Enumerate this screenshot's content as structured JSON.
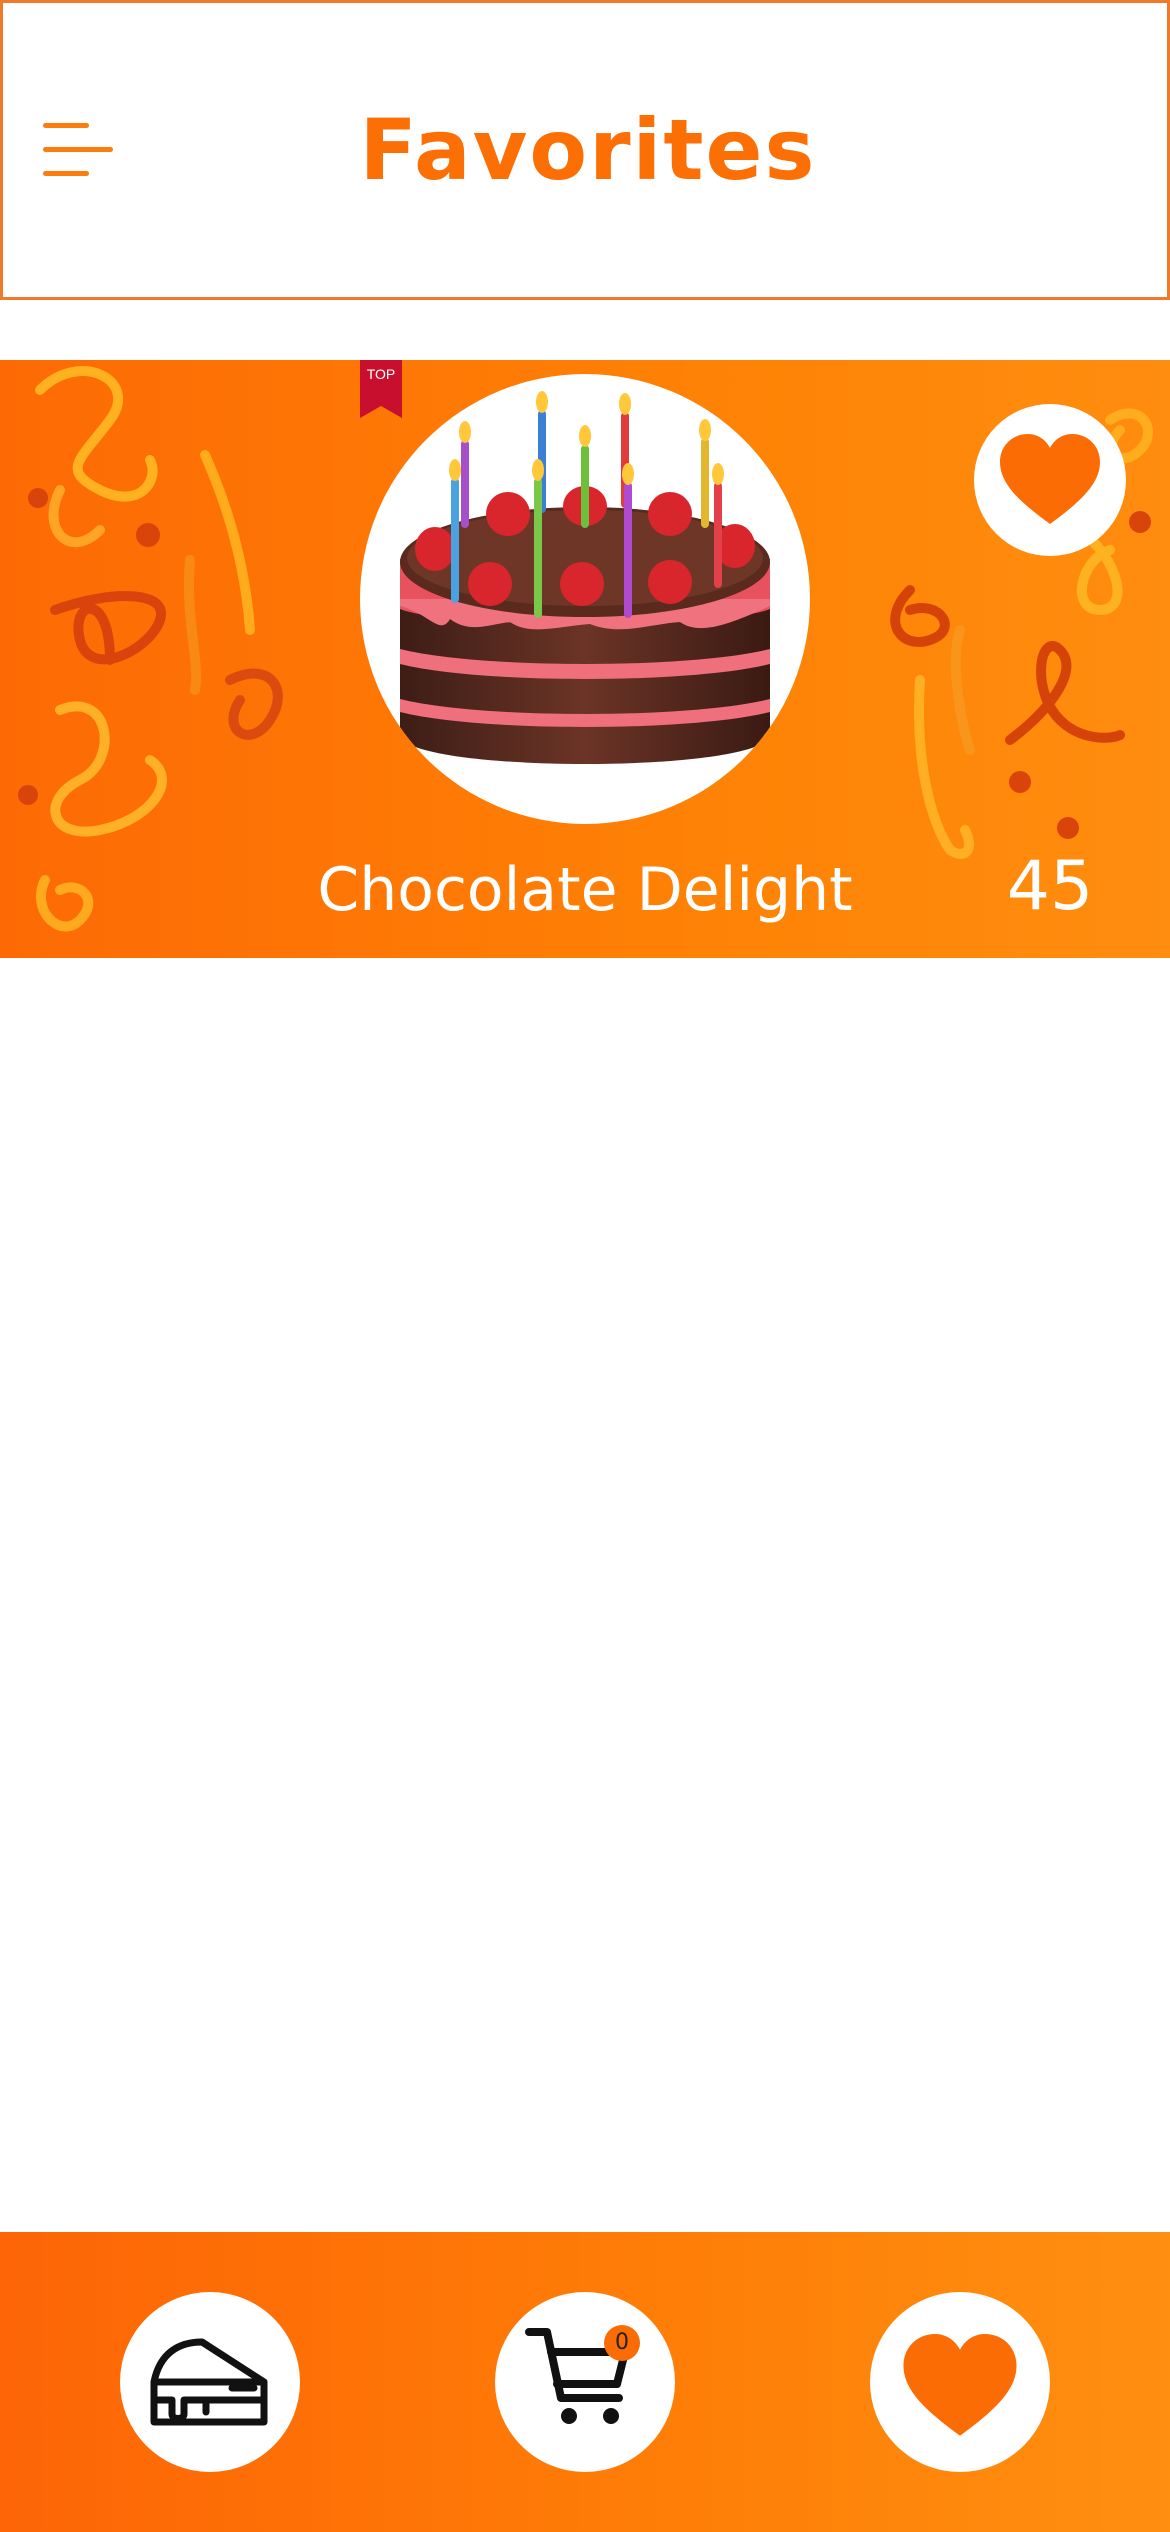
{
  "header": {
    "title": "Favorites",
    "menu_icon": "hamburger-menu-icon"
  },
  "favorites": [
    {
      "name": "Chocolate Delight",
      "count": "45",
      "badge": "TOP",
      "image": "chocolate-strawberry-birthday-cake",
      "favorited": true
    }
  ],
  "bottom_nav": {
    "items": [
      {
        "icon": "cake-slice-icon"
      },
      {
        "icon": "cart-icon",
        "badge": "0"
      },
      {
        "icon": "heart-icon"
      }
    ]
  },
  "colors": {
    "accent": "#fb6f05",
    "ribbon": "#c8102e",
    "white": "#ffffff"
  }
}
